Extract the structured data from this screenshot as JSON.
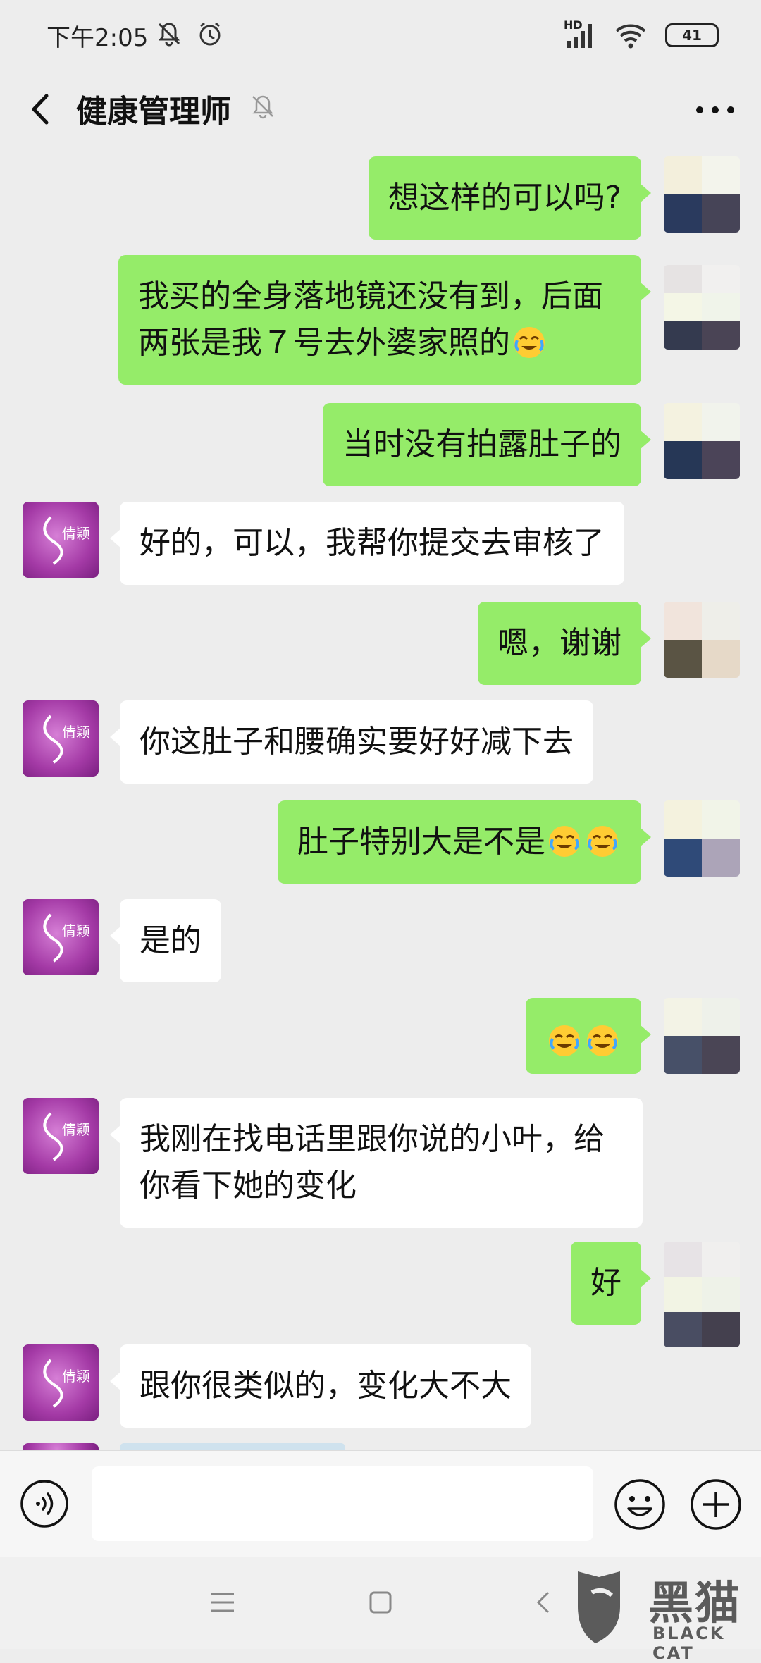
{
  "status_bar": {
    "time": "下午2:05",
    "signal_label": "HD",
    "battery": "41"
  },
  "header": {
    "title": "健康管理师"
  },
  "messages": [
    {
      "side": "sent",
      "text": "想这样的可以吗?"
    },
    {
      "side": "sent",
      "text": "我买的全身落地镜还没有到，后面两张是我７号去外婆家照的",
      "emoji": [
        "crying-laugh"
      ]
    },
    {
      "side": "sent",
      "text": "当时没有拍露肚子的"
    },
    {
      "side": "received",
      "text": "好的，可以，我帮你提交去审核了"
    },
    {
      "side": "sent",
      "text": "嗯，谢谢"
    },
    {
      "side": "received",
      "text": "你这肚子和腰确实要好好减下去"
    },
    {
      "side": "sent",
      "text": "肚子特别大是不是",
      "emoji": [
        "crying-laugh",
        "crying-laugh"
      ]
    },
    {
      "side": "received",
      "text": "是的"
    },
    {
      "side": "sent",
      "text": "",
      "emoji": [
        "crying-laugh",
        "crying-laugh"
      ]
    },
    {
      "side": "received",
      "text": "我刚在找电话里跟你说的小叶，给你看下她的变化"
    },
    {
      "side": "sent",
      "text": "好"
    },
    {
      "side": "received",
      "text": "跟你很类似的，变化大不大"
    }
  ],
  "avatar_other_text": "倩颖",
  "input": {
    "value": "",
    "placeholder": ""
  },
  "watermark": {
    "cn": "黑猫",
    "en": "BLACK CAT"
  },
  "colors": {
    "sent_bubble": "#95ec69",
    "received_bubble": "#ffffff",
    "background": "#ededed"
  }
}
